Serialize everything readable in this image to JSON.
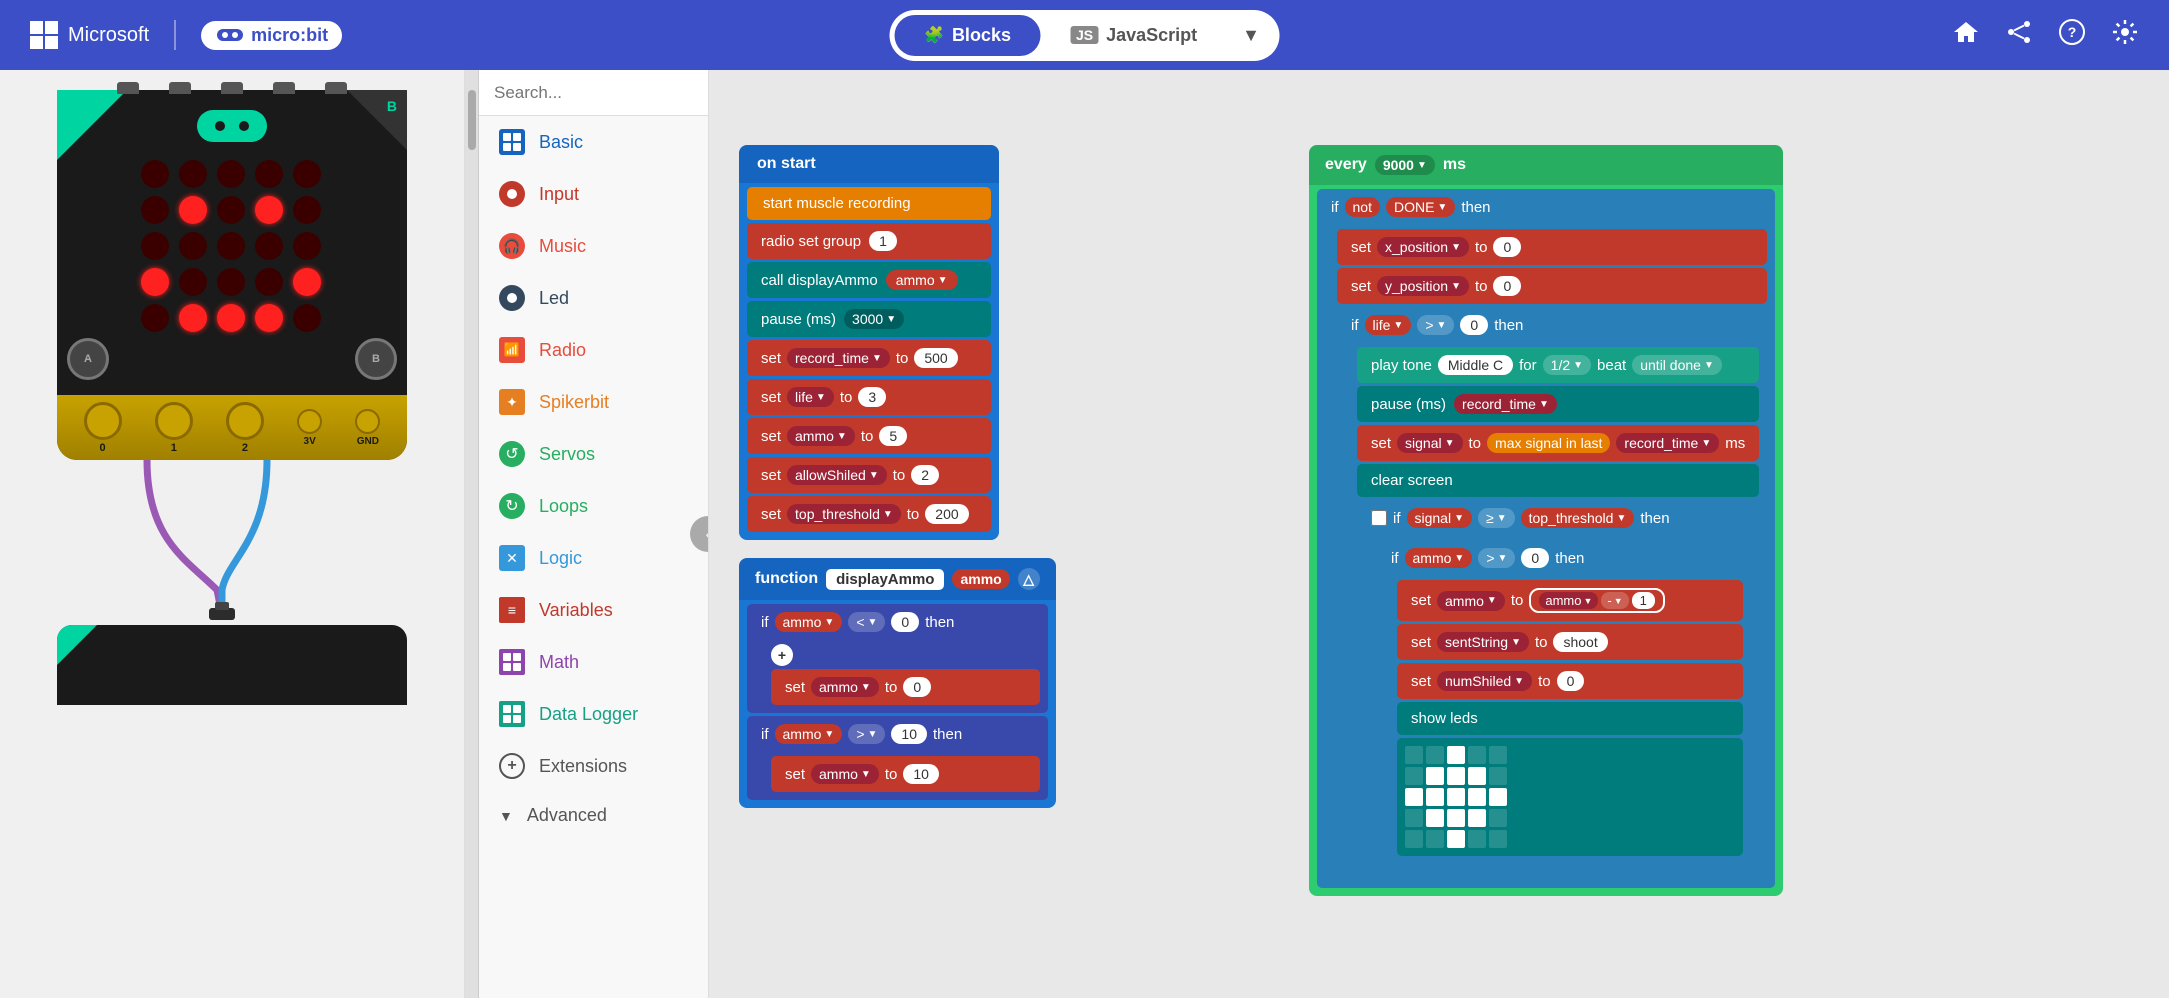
{
  "header": {
    "microsoft_label": "Microsoft",
    "microbit_label": "micro:bit",
    "blocks_label": "Blocks",
    "javascript_label": "JavaScript",
    "home_icon": "🏠",
    "share_icon": "🔗",
    "help_icon": "?",
    "settings_icon": "⚙"
  },
  "toolbox": {
    "search_placeholder": "Search...",
    "items": [
      {
        "label": "Basic",
        "color": "#1565c0",
        "icon": "⊞"
      },
      {
        "label": "Input",
        "color": "#c0392b",
        "icon": "●"
      },
      {
        "label": "Music",
        "color": "#e74c3c",
        "icon": "🎧"
      },
      {
        "label": "Led",
        "color": "#34495e",
        "icon": "●"
      },
      {
        "label": "Radio",
        "color": "#e74c3c",
        "icon": "📶"
      },
      {
        "label": "Spikerbit",
        "color": "#e67e22",
        "icon": "✦"
      },
      {
        "label": "Servos",
        "color": "#27ae60",
        "icon": "↺"
      },
      {
        "label": "Loops",
        "color": "#27ae60",
        "icon": "↻"
      },
      {
        "label": "Logic",
        "color": "#3498db",
        "icon": "✕"
      },
      {
        "label": "Variables",
        "color": "#c0392b",
        "icon": "≡"
      },
      {
        "label": "Math",
        "color": "#8e44ad",
        "icon": "⊞"
      },
      {
        "label": "Data Logger",
        "color": "#16a085",
        "icon": "⊞"
      },
      {
        "label": "Extensions",
        "color": "#555",
        "icon": "⊕"
      },
      {
        "label": "Advanced",
        "color": "#555",
        "icon": "▼"
      }
    ]
  },
  "blocks": {
    "on_start": {
      "header": "on start",
      "b1": "start muscle recording",
      "b2_label": "radio set group",
      "b2_val": "1",
      "b3_label": "call displayAmmo",
      "b3_param": "ammo",
      "b4_label": "pause (ms)",
      "b4_val": "3000",
      "b5_label": "set",
      "b5_var": "record_time",
      "b5_to": "to",
      "b5_val": "500",
      "b6_var": "life",
      "b6_val": "3",
      "b7_var": "ammo",
      "b7_val": "5",
      "b8_var": "allowShiled",
      "b8_val": "2",
      "b9_var": "top_threshold",
      "b9_val": "200"
    },
    "display_ammo": {
      "header": "function displayAmmo",
      "param": "ammo",
      "if_label": "if",
      "cond1_var": "ammo",
      "cond1_op": "<",
      "cond1_val": "0",
      "then_label": "then",
      "set_label": "set",
      "set_var": "ammo",
      "set_val": "0",
      "if2_label": "if",
      "cond2_var": "ammo",
      "cond2_op": ">",
      "cond2_val": "10",
      "then2_label": "then",
      "set2_var": "ammo",
      "set2_val": "10"
    },
    "every": {
      "header": "every",
      "interval": "9000",
      "unit": "ms",
      "if_label": "if",
      "not_label": "not",
      "done_var": "DONE",
      "then_label": "then",
      "set1_var": "x_position",
      "set1_val": "0",
      "set2_var": "y_position",
      "set2_val": "0",
      "if2_label": "if",
      "if2_var": "life",
      "if2_op": ">",
      "if2_val": "0",
      "if2_then": "then",
      "play_label": "play tone",
      "tone_val": "Middle C",
      "for_label": "for",
      "beat_val": "1/2",
      "beat_label": "beat",
      "until_label": "until done",
      "pause_label": "pause (ms)",
      "pause_var": "record_time",
      "set3_label": "set",
      "set3_var": "signal",
      "set3_to": "to",
      "set3_func": "max signal in last",
      "set3_param": "record_time",
      "set3_unit": "ms",
      "clear_label": "clear screen",
      "if3_label": "if",
      "if3_var": "signal",
      "if3_op": "≥",
      "if3_var2": "top_threshold",
      "if3_then": "then",
      "if4_label": "if",
      "if4_var": "ammo",
      "if4_op": ">",
      "if4_val": "0",
      "if4_then": "then",
      "set4_var": "ammo",
      "set4_val": "ammo",
      "set4_op": "-",
      "set4_num": "1",
      "set5_var": "sentString",
      "set5_val": "shoot",
      "set6_var": "numShiled",
      "set6_val": "0",
      "show_leds_label": "show leds"
    }
  },
  "led_pattern": [
    [
      0,
      0,
      0,
      0,
      0
    ],
    [
      0,
      1,
      0,
      1,
      0
    ],
    [
      0,
      0,
      0,
      0,
      0
    ],
    [
      1,
      0,
      0,
      0,
      1
    ],
    [
      0,
      1,
      1,
      1,
      0
    ]
  ],
  "show_leds_pattern": [
    [
      0,
      0,
      1,
      0,
      0
    ],
    [
      0,
      1,
      1,
      1,
      0
    ],
    [
      1,
      1,
      1,
      1,
      1
    ],
    [
      0,
      1,
      1,
      1,
      0
    ],
    [
      0,
      0,
      1,
      0,
      0
    ]
  ]
}
